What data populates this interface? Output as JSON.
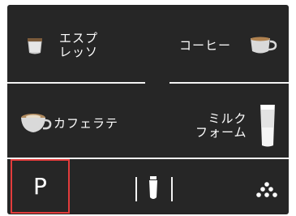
{
  "tiles": {
    "espresso": {
      "line1": "エスプ",
      "line2": "レッソ",
      "icon": "espresso-cup-icon"
    },
    "coffee": {
      "label": "コーヒー",
      "icon": "coffee-cup-icon"
    },
    "caffe_latte": {
      "label": "カフェラテ",
      "icon": "latte-cup-icon"
    },
    "milk_foam": {
      "line1": "ミルク",
      "line2": "フォーム",
      "icon": "milk-glass-icon"
    }
  },
  "bottom_bar": {
    "program_label": "P",
    "center_icon": "cartridge-icon",
    "right_icon": "grounds-icon"
  },
  "colors": {
    "screen_bg": "#262626",
    "foreground": "#ffffff",
    "accent_border": "#e33c3c"
  }
}
